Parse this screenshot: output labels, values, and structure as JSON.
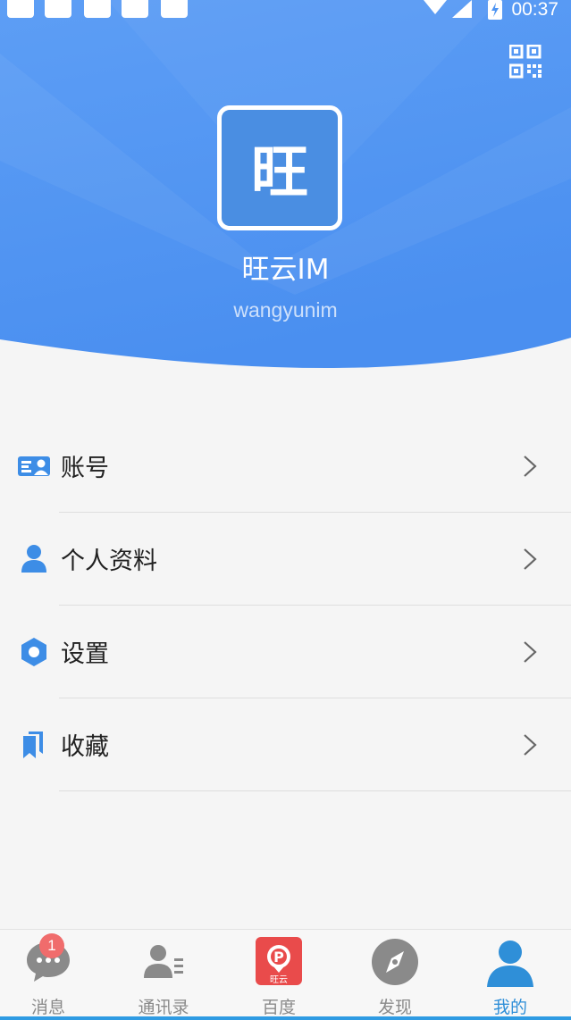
{
  "status_bar": {
    "time": "00:37"
  },
  "profile": {
    "avatar_char": "旺",
    "name": "旺云IM",
    "id": "wangyunim"
  },
  "menu": {
    "items": [
      {
        "label": "账号",
        "icon": "account-card-icon"
      },
      {
        "label": "个人资料",
        "icon": "person-icon"
      },
      {
        "label": "设置",
        "icon": "settings-hexagon-icon"
      },
      {
        "label": "收藏",
        "icon": "bookmark-icon"
      }
    ]
  },
  "bottom_nav": {
    "items": [
      {
        "label": "消息",
        "icon": "chat-bubble-icon",
        "badge": "1"
      },
      {
        "label": "通讯录",
        "icon": "contacts-icon"
      },
      {
        "label": "百度",
        "icon": "app-logo-icon",
        "icon_text": "旺云"
      },
      {
        "label": "发现",
        "icon": "compass-icon"
      },
      {
        "label": "我的",
        "icon": "me-person-icon",
        "active": true
      }
    ]
  },
  "colors": {
    "header_blue": "#4d94f2",
    "accent": "#2f8fd8",
    "badge": "#f06c6c",
    "app_logo": "#e94b4b"
  }
}
